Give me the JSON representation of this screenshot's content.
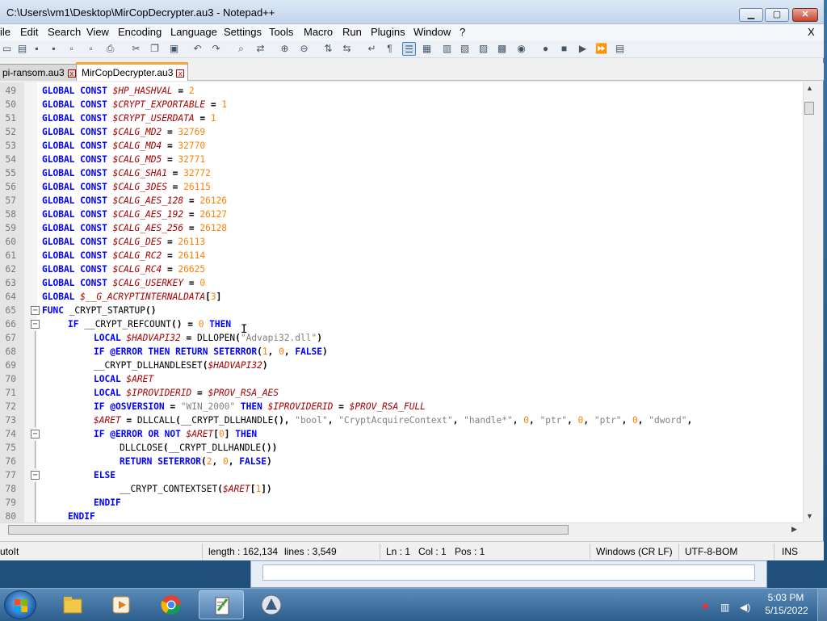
{
  "window": {
    "title": "C:\\Users\\vm1\\Desktop\\MirCopDecrypter.au3 - Notepad++",
    "min_label": "▁",
    "max_label": "▢",
    "close_label": "✕"
  },
  "menu": {
    "items": [
      "ile",
      "Edit",
      "Search",
      "View",
      "Encoding",
      "Language",
      "Settings",
      "Tools",
      "Macro",
      "Run",
      "Plugins",
      "Window",
      "?"
    ],
    "close": "X"
  },
  "toolbar": {
    "icons": [
      "new-file-icon",
      "open-file-icon",
      "save-icon",
      "save-all-icon",
      "close-file-icon",
      "close-all-icon",
      "print-icon",
      "cut-icon",
      "copy-icon",
      "paste-icon",
      "undo-icon",
      "redo-icon",
      "find-icon",
      "replace-icon",
      "zoom-in-icon",
      "zoom-out-icon",
      "sync-vertical-icon",
      "sync-horizontal-icon",
      "word-wrap-icon",
      "show-all-characters-icon",
      "indent-guide-icon",
      "user-language-icon",
      "document-map-icon",
      "function-list-icon",
      "folder-as-workspace-icon",
      "monitoring-icon",
      "record-macro-icon",
      "stop-macro-icon",
      "play-macro-icon",
      "run-macro-multiple-icon",
      "save-macro-icon"
    ]
  },
  "tabs": [
    {
      "label": "pi-ransom.au3",
      "active": false
    },
    {
      "label": "MirCopDecrypter.au3",
      "active": true
    }
  ],
  "editor": {
    "lines": [
      {
        "n": "49",
        "fold": "",
        "indent": 0,
        "tokens": [
          [
            "kw",
            "GLOBAL "
          ],
          [
            "kw",
            "CONST "
          ],
          [
            "var",
            "$HP_HASHVAL"
          ],
          [
            "op",
            " = "
          ],
          [
            "num",
            "2"
          ]
        ]
      },
      {
        "n": "50",
        "fold": "",
        "indent": 0,
        "tokens": [
          [
            "kw",
            "GLOBAL "
          ],
          [
            "kw",
            "CONST "
          ],
          [
            "var",
            "$CRYPT_EXPORTABLE"
          ],
          [
            "op",
            " = "
          ],
          [
            "num",
            "1"
          ]
        ]
      },
      {
        "n": "51",
        "fold": "",
        "indent": 0,
        "tokens": [
          [
            "kw",
            "GLOBAL "
          ],
          [
            "kw",
            "CONST "
          ],
          [
            "var",
            "$CRYPT_USERDATA"
          ],
          [
            "op",
            " = "
          ],
          [
            "num",
            "1"
          ]
        ]
      },
      {
        "n": "52",
        "fold": "",
        "indent": 0,
        "tokens": [
          [
            "kw",
            "GLOBAL "
          ],
          [
            "kw",
            "CONST "
          ],
          [
            "var",
            "$CALG_MD2"
          ],
          [
            "op",
            " = "
          ],
          [
            "num",
            "32769"
          ]
        ]
      },
      {
        "n": "53",
        "fold": "",
        "indent": 0,
        "tokens": [
          [
            "kw",
            "GLOBAL "
          ],
          [
            "kw",
            "CONST "
          ],
          [
            "var",
            "$CALG_MD4"
          ],
          [
            "op",
            " = "
          ],
          [
            "num",
            "32770"
          ]
        ]
      },
      {
        "n": "54",
        "fold": "",
        "indent": 0,
        "tokens": [
          [
            "kw",
            "GLOBAL "
          ],
          [
            "kw",
            "CONST "
          ],
          [
            "var",
            "$CALG_MD5"
          ],
          [
            "op",
            " = "
          ],
          [
            "num",
            "32771"
          ]
        ]
      },
      {
        "n": "55",
        "fold": "",
        "indent": 0,
        "tokens": [
          [
            "kw",
            "GLOBAL "
          ],
          [
            "kw",
            "CONST "
          ],
          [
            "var",
            "$CALG_SHA1"
          ],
          [
            "op",
            " = "
          ],
          [
            "num",
            "32772"
          ]
        ]
      },
      {
        "n": "56",
        "fold": "",
        "indent": 0,
        "tokens": [
          [
            "kw",
            "GLOBAL "
          ],
          [
            "kw",
            "CONST "
          ],
          [
            "var",
            "$CALG_3DES"
          ],
          [
            "op",
            " = "
          ],
          [
            "num",
            "26115"
          ]
        ]
      },
      {
        "n": "57",
        "fold": "",
        "indent": 0,
        "tokens": [
          [
            "kw",
            "GLOBAL "
          ],
          [
            "kw",
            "CONST "
          ],
          [
            "var",
            "$CALG_AES_128"
          ],
          [
            "op",
            " = "
          ],
          [
            "num",
            "26126"
          ]
        ]
      },
      {
        "n": "58",
        "fold": "",
        "indent": 0,
        "tokens": [
          [
            "kw",
            "GLOBAL "
          ],
          [
            "kw",
            "CONST "
          ],
          [
            "var",
            "$CALG_AES_192"
          ],
          [
            "op",
            " = "
          ],
          [
            "num",
            "26127"
          ]
        ]
      },
      {
        "n": "59",
        "fold": "",
        "indent": 0,
        "tokens": [
          [
            "kw",
            "GLOBAL "
          ],
          [
            "kw",
            "CONST "
          ],
          [
            "var",
            "$CALG_AES_256"
          ],
          [
            "op",
            " = "
          ],
          [
            "num",
            "26128"
          ]
        ]
      },
      {
        "n": "60",
        "fold": "",
        "indent": 0,
        "tokens": [
          [
            "kw",
            "GLOBAL "
          ],
          [
            "kw",
            "CONST "
          ],
          [
            "var",
            "$CALG_DES"
          ],
          [
            "op",
            " = "
          ],
          [
            "num",
            "26113"
          ]
        ]
      },
      {
        "n": "61",
        "fold": "",
        "indent": 0,
        "tokens": [
          [
            "kw",
            "GLOBAL "
          ],
          [
            "kw",
            "CONST "
          ],
          [
            "var",
            "$CALG_RC2"
          ],
          [
            "op",
            " = "
          ],
          [
            "num",
            "26114"
          ]
        ]
      },
      {
        "n": "62",
        "fold": "",
        "indent": 0,
        "tokens": [
          [
            "kw",
            "GLOBAL "
          ],
          [
            "kw",
            "CONST "
          ],
          [
            "var",
            "$CALG_RC4"
          ],
          [
            "op",
            " = "
          ],
          [
            "num",
            "26625"
          ]
        ]
      },
      {
        "n": "63",
        "fold": "",
        "indent": 0,
        "tokens": [
          [
            "kw",
            "GLOBAL "
          ],
          [
            "kw",
            "CONST "
          ],
          [
            "var",
            "$CALG_USERKEY"
          ],
          [
            "op",
            " = "
          ],
          [
            "num",
            "0"
          ]
        ]
      },
      {
        "n": "64",
        "fold": "",
        "indent": 0,
        "tokens": [
          [
            "kw",
            "GLOBAL "
          ],
          [
            "var",
            "$__G_ACRYPTINTERNALDATA"
          ],
          [
            "op",
            "["
          ],
          [
            "num",
            "3"
          ],
          [
            "op",
            "]"
          ]
        ]
      },
      {
        "n": "65",
        "fold": "box",
        "indent": 0,
        "tokens": [
          [
            "kw",
            "FUNC "
          ],
          [
            "id",
            "_CRYPT_STARTUP"
          ],
          [
            "op",
            "()"
          ]
        ]
      },
      {
        "n": "66",
        "fold": "box",
        "indent": 1,
        "tokens": [
          [
            "kw",
            "IF "
          ],
          [
            "id",
            "__CRYPT_REFCOUNT"
          ],
          [
            "op",
            "() = "
          ],
          [
            "num",
            "0"
          ],
          [
            "kw",
            " THEN"
          ]
        ]
      },
      {
        "n": "67",
        "fold": "line",
        "indent": 2,
        "tokens": [
          [
            "kw",
            "LOCAL "
          ],
          [
            "var",
            "$HADVAPI32"
          ],
          [
            "op",
            " = "
          ],
          [
            "id",
            "DLLOPEN"
          ],
          [
            "op",
            "("
          ],
          [
            "str",
            "\"Advapi32.dll\""
          ],
          [
            "op",
            ")"
          ]
        ]
      },
      {
        "n": "68",
        "fold": "line",
        "indent": 2,
        "tokens": [
          [
            "kw",
            "IF "
          ],
          [
            "mac",
            "@ERROR"
          ],
          [
            "kw",
            " THEN "
          ],
          [
            "kw",
            "RETURN "
          ],
          [
            "kw",
            "SETERROR"
          ],
          [
            "op",
            "("
          ],
          [
            "num",
            "1"
          ],
          [
            "op",
            ", "
          ],
          [
            "num",
            "0"
          ],
          [
            "op",
            ", "
          ],
          [
            "kw",
            "FALSE"
          ],
          [
            "op",
            ")"
          ]
        ]
      },
      {
        "n": "69",
        "fold": "line",
        "indent": 2,
        "tokens": [
          [
            "id",
            "__CRYPT_DLLHANDLESET"
          ],
          [
            "op",
            "("
          ],
          [
            "var",
            "$HADVAPI32"
          ],
          [
            "op",
            ")"
          ]
        ]
      },
      {
        "n": "70",
        "fold": "line",
        "indent": 2,
        "tokens": [
          [
            "kw",
            "LOCAL "
          ],
          [
            "var",
            "$ARET"
          ]
        ]
      },
      {
        "n": "71",
        "fold": "line",
        "indent": 2,
        "tokens": [
          [
            "kw",
            "LOCAL "
          ],
          [
            "var",
            "$IPROVIDERID"
          ],
          [
            "op",
            " = "
          ],
          [
            "var",
            "$PROV_RSA_AES"
          ]
        ]
      },
      {
        "n": "72",
        "fold": "line",
        "indent": 2,
        "tokens": [
          [
            "kw",
            "IF "
          ],
          [
            "mac",
            "@OSVERSION"
          ],
          [
            "op",
            " = "
          ],
          [
            "str",
            "\"WIN_2000\""
          ],
          [
            "kw",
            " THEN "
          ],
          [
            "var",
            "$IPROVIDERID"
          ],
          [
            "op",
            " = "
          ],
          [
            "var",
            "$PROV_RSA_FULL"
          ]
        ]
      },
      {
        "n": "73",
        "fold": "line",
        "indent": 2,
        "tokens": [
          [
            "var",
            "$ARET"
          ],
          [
            "op",
            " = "
          ],
          [
            "id",
            "DLLCALL"
          ],
          [
            "op",
            "("
          ],
          [
            "id",
            "__CRYPT_DLLHANDLE"
          ],
          [
            "op",
            "(), "
          ],
          [
            "str",
            "\"bool\""
          ],
          [
            "op",
            ", "
          ],
          [
            "str",
            "\"CryptAcquireContext\""
          ],
          [
            "op",
            ", "
          ],
          [
            "str",
            "\"handle*\""
          ],
          [
            "op",
            ", "
          ],
          [
            "num",
            "0"
          ],
          [
            "op",
            ", "
          ],
          [
            "str",
            "\"ptr\""
          ],
          [
            "op",
            ", "
          ],
          [
            "num",
            "0"
          ],
          [
            "op",
            ", "
          ],
          [
            "str",
            "\"ptr\""
          ],
          [
            "op",
            ", "
          ],
          [
            "num",
            "0"
          ],
          [
            "op",
            ", "
          ],
          [
            "str",
            "\"dword\""
          ],
          [
            "op",
            ","
          ]
        ]
      },
      {
        "n": "74",
        "fold": "box",
        "indent": 2,
        "tokens": [
          [
            "kw",
            "IF "
          ],
          [
            "mac",
            "@ERROR"
          ],
          [
            "kw",
            " OR "
          ],
          [
            "kw",
            "NOT "
          ],
          [
            "var",
            "$ARET"
          ],
          [
            "op",
            "["
          ],
          [
            "num",
            "0"
          ],
          [
            "op",
            "]"
          ],
          [
            "kw",
            " THEN"
          ]
        ]
      },
      {
        "n": "75",
        "fold": "line",
        "indent": 3,
        "tokens": [
          [
            "id",
            "DLLCLOSE"
          ],
          [
            "op",
            "("
          ],
          [
            "id",
            "__CRYPT_DLLHANDLE"
          ],
          [
            "op",
            "())"
          ]
        ]
      },
      {
        "n": "76",
        "fold": "line",
        "indent": 3,
        "tokens": [
          [
            "kw",
            "RETURN "
          ],
          [
            "kw",
            "SETERROR"
          ],
          [
            "op",
            "("
          ],
          [
            "num",
            "2"
          ],
          [
            "op",
            ", "
          ],
          [
            "num",
            "0"
          ],
          [
            "op",
            ", "
          ],
          [
            "kw",
            "FALSE"
          ],
          [
            "op",
            ")"
          ]
        ]
      },
      {
        "n": "77",
        "fold": "box",
        "indent": 2,
        "tokens": [
          [
            "kw",
            "ELSE"
          ]
        ]
      },
      {
        "n": "78",
        "fold": "line",
        "indent": 3,
        "tokens": [
          [
            "id",
            "__CRYPT_CONTEXTSET"
          ],
          [
            "op",
            "("
          ],
          [
            "var",
            "$ARET"
          ],
          [
            "op",
            "["
          ],
          [
            "num",
            "1"
          ],
          [
            "op",
            "])"
          ]
        ]
      },
      {
        "n": "79",
        "fold": "line",
        "indent": 2,
        "tokens": [
          [
            "kw",
            "ENDIF"
          ]
        ]
      },
      {
        "n": "80",
        "fold": "line",
        "indent": 1,
        "tokens": [
          [
            "kw",
            "ENDIF"
          ]
        ]
      }
    ]
  },
  "status": {
    "language": "utoIt",
    "length": "length : 162,134",
    "lines": "lines : 3,549",
    "ln": "Ln : 1",
    "col": "Col : 1",
    "pos": "Pos : 1",
    "eol": "Windows (CR LF)",
    "encoding": "UTF-8-BOM",
    "mode": "INS"
  },
  "taskbar": {
    "apps": [
      "file-explorer-icon",
      "media-player-icon",
      "chrome-icon",
      "notepad-plus-plus-icon",
      "autoit-icon"
    ],
    "active_app": "notepad-plus-plus-icon",
    "time": "5:03 PM",
    "date": "5/15/2022"
  },
  "colors": {
    "keyword": "#0000ff",
    "variable": "#aa0000",
    "number": "#ff8000",
    "string": "#808080"
  }
}
